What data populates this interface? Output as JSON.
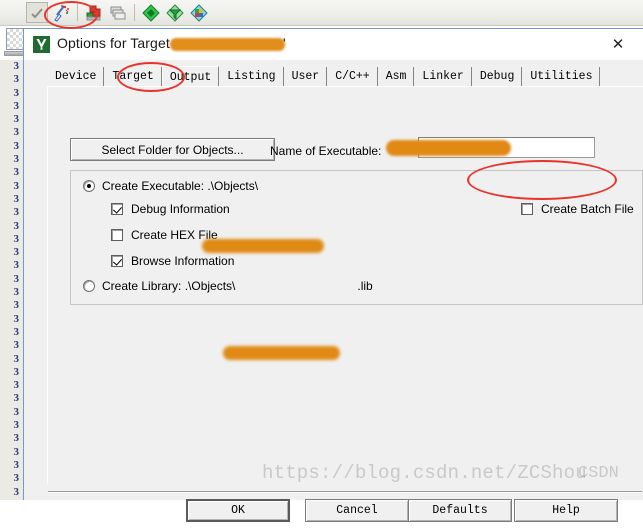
{
  "toolbar": {
    "buttons": [
      {
        "name": "check-build-icon",
        "label": "Translate"
      },
      {
        "name": "magic-wand-icon",
        "label": "Rebuild"
      },
      {
        "name": "build-target-icon",
        "label": "Build"
      },
      {
        "name": "batch-build-icon",
        "label": "Batch Build"
      },
      {
        "name": "green-diamond-icon",
        "label": "Target Options"
      },
      {
        "name": "funnel-icon",
        "label": "Manage Components"
      },
      {
        "name": "multi-diamond-icon",
        "label": "Manage Project Items"
      }
    ]
  },
  "editor": {
    "line_number": "3",
    "line_count": 33
  },
  "dialog": {
    "title": "Options for Target ",
    "title_quote": "'",
    "close_label": "✕",
    "app_icon": "keil-uvision-icon",
    "tabs": [
      {
        "label": "Device",
        "active": false
      },
      {
        "label": "Target",
        "active": false
      },
      {
        "label": "Output",
        "active": true
      },
      {
        "label": "Listing",
        "active": false
      },
      {
        "label": "User",
        "active": false
      },
      {
        "label": "C/C++",
        "active": false
      },
      {
        "label": "Asm",
        "active": false
      },
      {
        "label": "Linker",
        "active": false
      },
      {
        "label": "Debug",
        "active": false
      },
      {
        "label": "Utilities",
        "active": false
      }
    ],
    "output_tab": {
      "select_folder_button": "Select Folder for Objects...",
      "name_of_executable_label": "Name of Executable:",
      "name_of_executable_value": "",
      "create_executable": {
        "label": "Create Executable:  .\\Objects\\",
        "selected": true
      },
      "debug_information": {
        "label": "Debug Information",
        "checked": true
      },
      "create_hex_file": {
        "label": "Create HEX File",
        "checked": false
      },
      "browse_information": {
        "label": "Browse Information",
        "checked": true
      },
      "create_batch_file": {
        "label": "Create Batch File",
        "checked": false
      },
      "create_library": {
        "label_prefix": "Create Library:  .\\Objects\\",
        "label_suffix": ".lib",
        "selected": false
      }
    },
    "buttons": {
      "ok": "OK",
      "cancel": "Cancel",
      "defaults": "Defaults",
      "help": "Help"
    }
  },
  "watermark": {
    "text": "https://blog.csdn.net/ZCShou",
    "tail": "CSDN"
  },
  "colors": {
    "dialog_bg": "#f0f0f0",
    "titlebar_bg": "#ffffff",
    "border_blue": "#6f9bd1",
    "annotation_red": "#e8342a",
    "redaction_orange": "#e08a15",
    "line_number_blue": "#2b3a78"
  }
}
